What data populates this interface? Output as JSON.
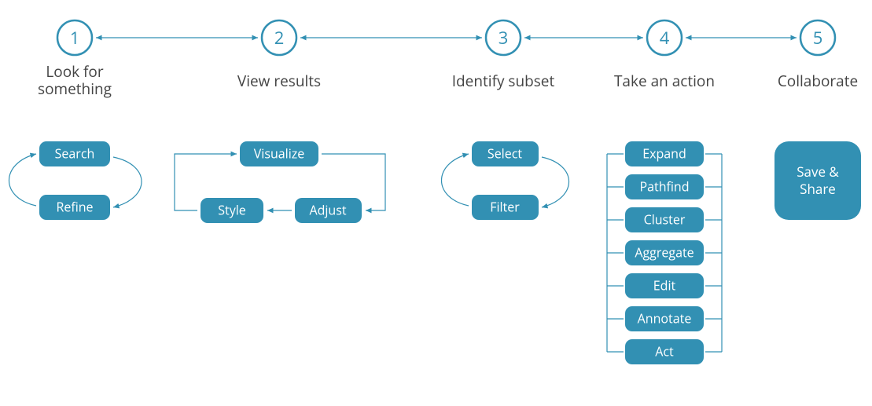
{
  "colors": {
    "accent": "#3290b3",
    "text": "#444444",
    "pill_text": "#ffffff"
  },
  "steps": [
    {
      "num": "1",
      "label_lines": [
        "Look for",
        "something"
      ]
    },
    {
      "num": "2",
      "label_lines": [
        "View results"
      ]
    },
    {
      "num": "3",
      "label_lines": [
        "Identify subset"
      ]
    },
    {
      "num": "4",
      "label_lines": [
        "Take an action"
      ]
    },
    {
      "num": "5",
      "label_lines": [
        "Collaborate"
      ]
    }
  ],
  "group1": {
    "top": "Search",
    "bottom": "Refine"
  },
  "group2": {
    "top": "Visualize",
    "bl": "Style",
    "br": "Adjust"
  },
  "group3": {
    "top": "Select",
    "bottom": "Filter"
  },
  "group4": {
    "items": [
      "Expand",
      "Pathfind",
      "Cluster",
      "Aggregate",
      "Edit",
      "Annotate",
      "Act"
    ]
  },
  "group5": {
    "lines": [
      "Save &",
      "Share"
    ]
  }
}
